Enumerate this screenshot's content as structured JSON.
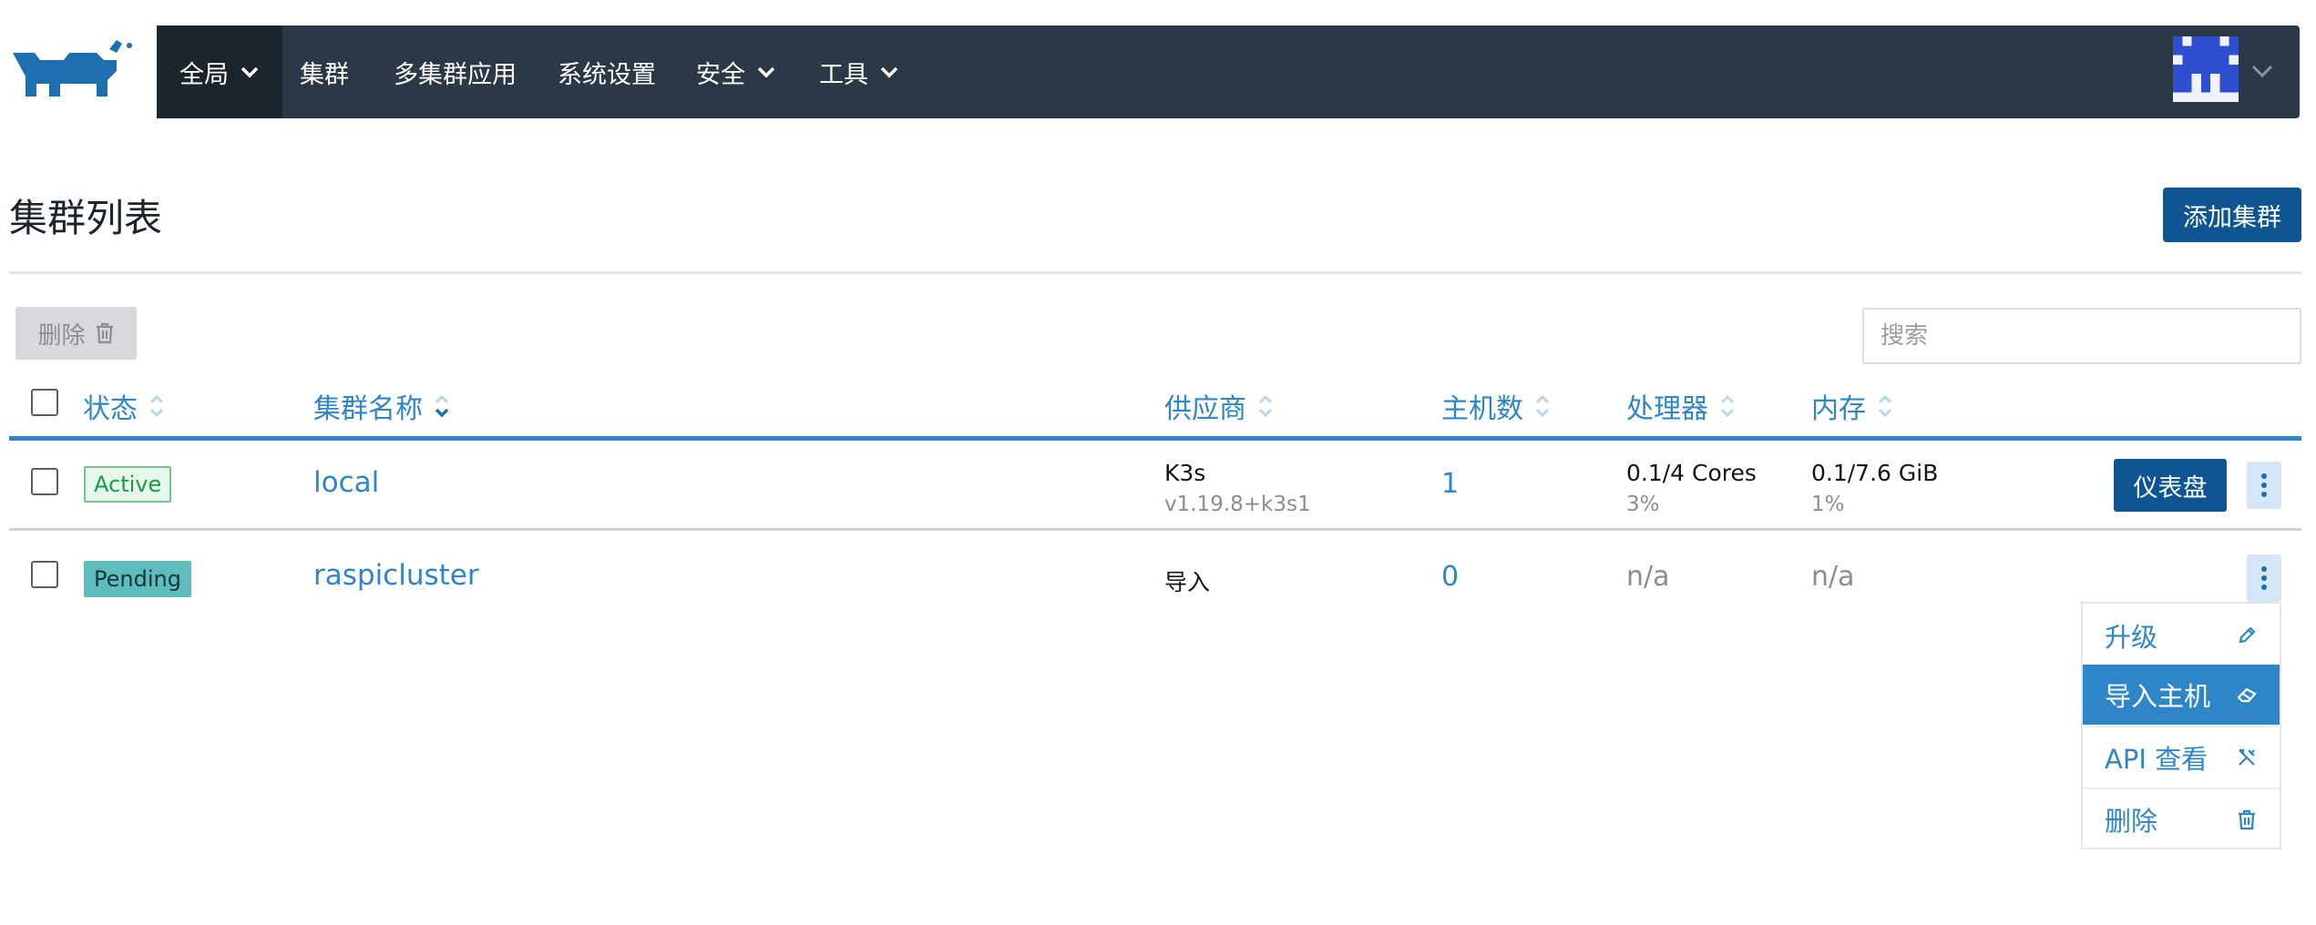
{
  "nav": {
    "items": [
      {
        "label": "全局",
        "has_dropdown": true,
        "active": true
      },
      {
        "label": "集群",
        "has_dropdown": false
      },
      {
        "label": "多集群应用",
        "has_dropdown": false
      },
      {
        "label": "系统设置",
        "has_dropdown": false
      },
      {
        "label": "安全",
        "has_dropdown": true
      },
      {
        "label": "工具",
        "has_dropdown": true
      }
    ],
    "user_icon": "avatar-icon"
  },
  "page": {
    "title": "集群列表",
    "add_button": "添加集群"
  },
  "toolbar": {
    "delete_label": "删除",
    "search_placeholder": "搜索"
  },
  "table": {
    "headers": [
      "状态",
      "集群名称",
      "供应商",
      "主机数",
      "处理器",
      "内存"
    ],
    "rows": [
      {
        "status": "Active",
        "name": "local",
        "provider": "K3s",
        "provider_version": "v1.19.8+k3s1",
        "hosts": "1",
        "cpu": "0.1/4 Cores",
        "cpu_pct": "3%",
        "memory": "0.1/7.6 GiB",
        "memory_pct": "1%",
        "action_button": "仪表盘"
      },
      {
        "status": "Pending",
        "name": "raspicluster",
        "provider": "导入",
        "hosts": "0",
        "cpu": "n/a",
        "memory": "n/a"
      }
    ]
  },
  "row_menu": {
    "items": [
      {
        "label": "升级",
        "icon": "pencil-icon"
      },
      {
        "label": "导入主机",
        "icon": "eraser-icon",
        "highlighted": true
      },
      {
        "label": "API 查看",
        "icon": "tools-icon"
      },
      {
        "label": "删除",
        "icon": "trash-icon"
      }
    ]
  },
  "colors": {
    "header_bg": "#2b3947",
    "primary": "#0f5592",
    "link": "#2e86c8",
    "active_badge": "#1a9b48",
    "pending_badge": "#5fbcbd"
  }
}
